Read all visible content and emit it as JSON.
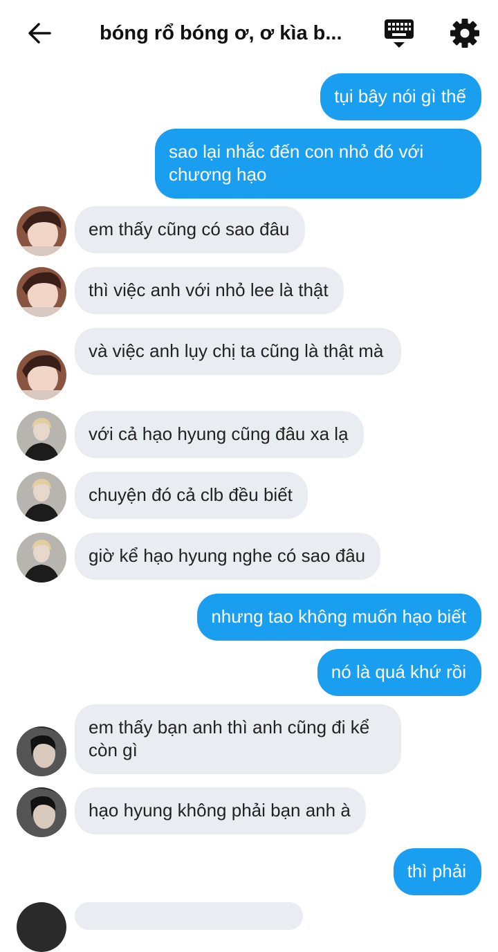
{
  "header": {
    "title": "bóng rổ bóng ơ, ơ kìa b..."
  },
  "icons": {
    "back": "arrow-left-icon",
    "keyboard": "keyboard-icon",
    "settings": "gear-icon"
  },
  "colors": {
    "outgoing_bubble": "#1a9ef0",
    "incoming_bubble": "#e9ecf0"
  },
  "messages": [
    {
      "side": "out",
      "text": "tụi bây nói gì thế"
    },
    {
      "side": "out",
      "text": "sao lại nhắc đến con nhỏ đó với chương hạo"
    },
    {
      "side": "in",
      "sender": "A",
      "text": "em thấy cũng có sao đâu"
    },
    {
      "side": "in",
      "sender": "A",
      "text": "thì việc anh với nhỏ lee là thật"
    },
    {
      "side": "in",
      "sender": "A",
      "text": "và việc anh lụy chị ta cũng là thật mà"
    },
    {
      "side": "in",
      "sender": "B",
      "text": "với cả hạo hyung cũng đâu xa lạ"
    },
    {
      "side": "in",
      "sender": "B",
      "text": "chuyện đó cả clb đều biết"
    },
    {
      "side": "in",
      "sender": "B",
      "text": "giờ kể hạo hyung nghe có sao đâu"
    },
    {
      "side": "out",
      "text": "nhưng tao không muốn hạo biết"
    },
    {
      "side": "out",
      "text": "nó là quá khứ rồi"
    },
    {
      "side": "in",
      "sender": "C",
      "text": "em thấy bạn anh thì anh cũng đi kể còn gì"
    },
    {
      "side": "in",
      "sender": "C",
      "text": "hạo hyung không phải bạn anh à"
    },
    {
      "side": "out",
      "text": "thì phải"
    }
  ]
}
